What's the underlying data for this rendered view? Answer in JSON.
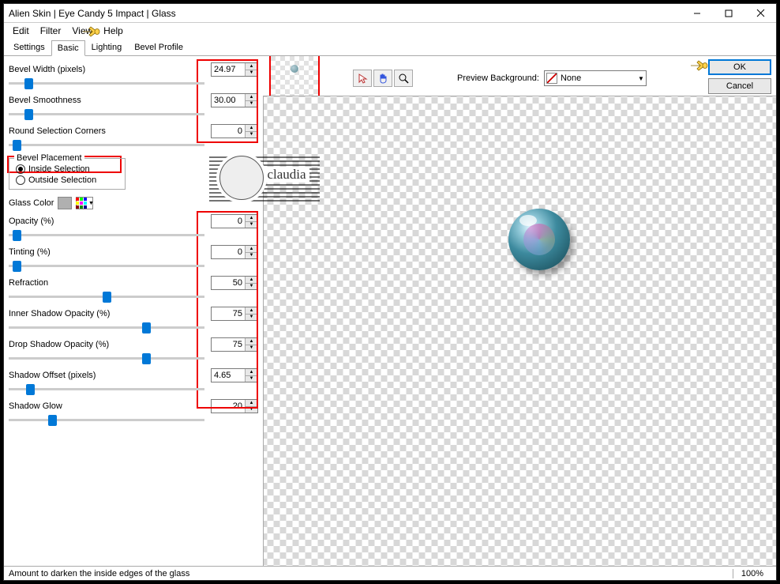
{
  "window": {
    "title": "Alien Skin | Eye Candy 5 Impact | Glass"
  },
  "menus": {
    "edit": "Edit",
    "filter": "Filter",
    "view": "View",
    "help": "Help"
  },
  "tabs": {
    "settings": "Settings",
    "basic": "Basic",
    "lighting": "Lighting",
    "bevel_profile": "Bevel Profile"
  },
  "buttons": {
    "ok": "OK",
    "cancel": "Cancel"
  },
  "preview": {
    "label": "Preview Background:",
    "value": "None"
  },
  "params": {
    "bevel_width": {
      "label": "Bevel Width (pixels)",
      "value": "24.97",
      "pos": 8
    },
    "bevel_smoothness": {
      "label": "Bevel Smoothness",
      "value": "30.00",
      "pos": 8
    },
    "round_corners": {
      "label": "Round Selection Corners",
      "value": "0",
      "pos": 2
    },
    "bevel_placement": {
      "legend": "Bevel Placement",
      "inside": "Inside Selection",
      "outside": "Outside Selection"
    },
    "glass_color": {
      "label": "Glass Color"
    },
    "opacity": {
      "label": "Opacity (%)",
      "value": "0",
      "pos": 2
    },
    "tinting": {
      "label": "Tinting (%)",
      "value": "0",
      "pos": 2
    },
    "refraction": {
      "label": "Refraction",
      "value": "50",
      "pos": 48
    },
    "inner_shadow": {
      "label": "Inner Shadow Opacity (%)",
      "value": "75",
      "pos": 68
    },
    "drop_shadow": {
      "label": "Drop Shadow Opacity (%)",
      "value": "75",
      "pos": 68
    },
    "shadow_offset": {
      "label": "Shadow Offset (pixels)",
      "value": "4.65",
      "pos": 9
    },
    "shadow_glow": {
      "label": "Shadow Glow",
      "value": "20",
      "pos": 20
    }
  },
  "status": {
    "hint": "Amount to darken the inside edges of the glass",
    "zoom": "100%"
  },
  "watermark": "claudia"
}
